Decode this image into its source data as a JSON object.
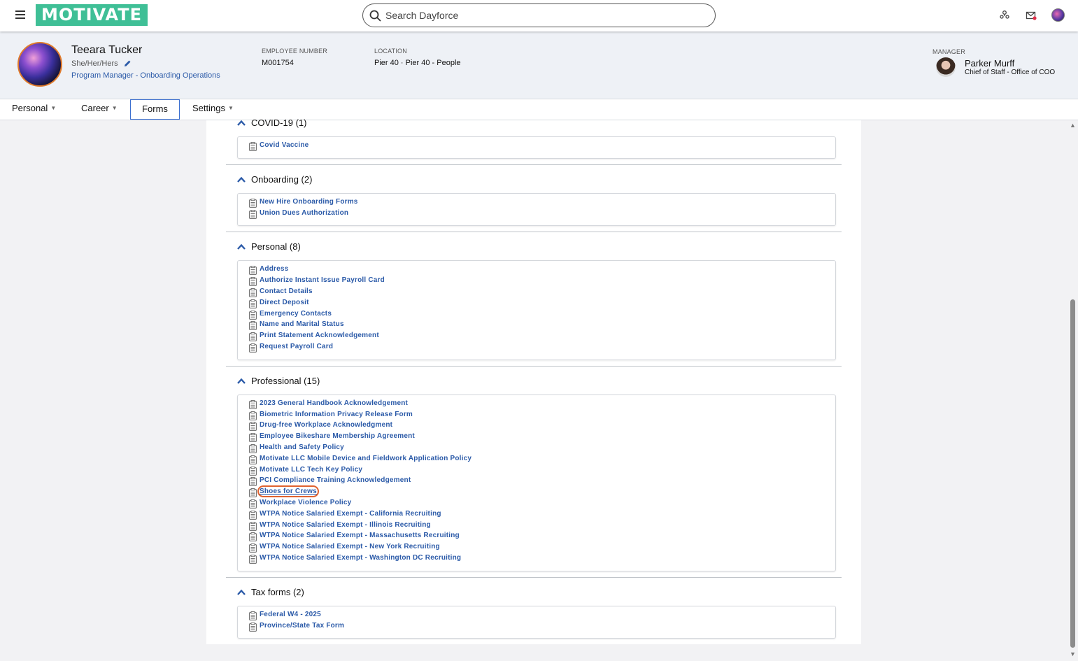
{
  "topbar": {
    "logo_text": "MOTIVATE",
    "search_placeholder": "Search Dayforce",
    "icons": [
      "menu-icon",
      "search-icon",
      "people-icon",
      "mail-icon",
      "avatar"
    ],
    "accent_color": "#3fbf96"
  },
  "employee": {
    "name": "Teeara Tucker",
    "pronouns": "She/Her/Hers",
    "job_title": "Program Manager - Onboarding Operations",
    "employee_number_label": "EMPLOYEE NUMBER",
    "employee_number": "M001754",
    "location_label": "LOCATION",
    "location": "Pier 40 · Pier 40 - People"
  },
  "manager": {
    "label": "MANAGER",
    "name": "Parker Murff",
    "title": "Chief of Staff - Office of COO"
  },
  "tabs": [
    {
      "label": "Personal",
      "has_dropdown": true
    },
    {
      "label": "Career",
      "has_dropdown": true
    },
    {
      "label": "Forms",
      "has_dropdown": false,
      "active": true
    },
    {
      "label": "Settings",
      "has_dropdown": true
    }
  ],
  "sections": [
    {
      "title": "COVID-19 (1)",
      "items": [
        "Covid Vaccine"
      ]
    },
    {
      "title": "Onboarding (2)",
      "items": [
        "New Hire Onboarding Forms",
        "Union Dues Authorization"
      ]
    },
    {
      "title": "Personal (8)",
      "items": [
        "Address",
        "Authorize Instant Issue Payroll Card",
        "Contact Details",
        "Direct Deposit",
        "Emergency Contacts",
        "Name and Marital Status",
        "Print Statement Acknowledgement",
        "Request Payroll Card"
      ]
    },
    {
      "title": "Professional (15)",
      "items": [
        "2023 General Handbook Acknowledgement",
        "Biometric Information Privacy Release Form",
        "Drug-free Workplace Acknowledgment",
        "Employee Bikeshare Membership Agreement",
        "Health and Safety Policy",
        "Motivate LLC Mobile Device and Fieldwork Application Policy",
        "Motivate LLC Tech Key Policy",
        "PCI Compliance Training Acknowledgement",
        "Shoes for Crews",
        "Workplace Violence Policy",
        "WTPA Notice Salaried Exempt - California Recruiting",
        "WTPA Notice Salaried Exempt - Illinois Recruiting",
        "WTPA Notice Salaried Exempt - Massachusetts Recruiting",
        "WTPA Notice Salaried Exempt - New York Recruiting",
        "WTPA Notice Salaried Exempt - Washington DC Recruiting"
      ]
    },
    {
      "title": "Tax forms (2)",
      "items": [
        "Federal W4 - 2025",
        "Province/State Tax Form"
      ]
    }
  ],
  "highlighted_item": "Shoes for Crews",
  "link_color": "#2b5aa8",
  "highlight_color": "#e0622f"
}
